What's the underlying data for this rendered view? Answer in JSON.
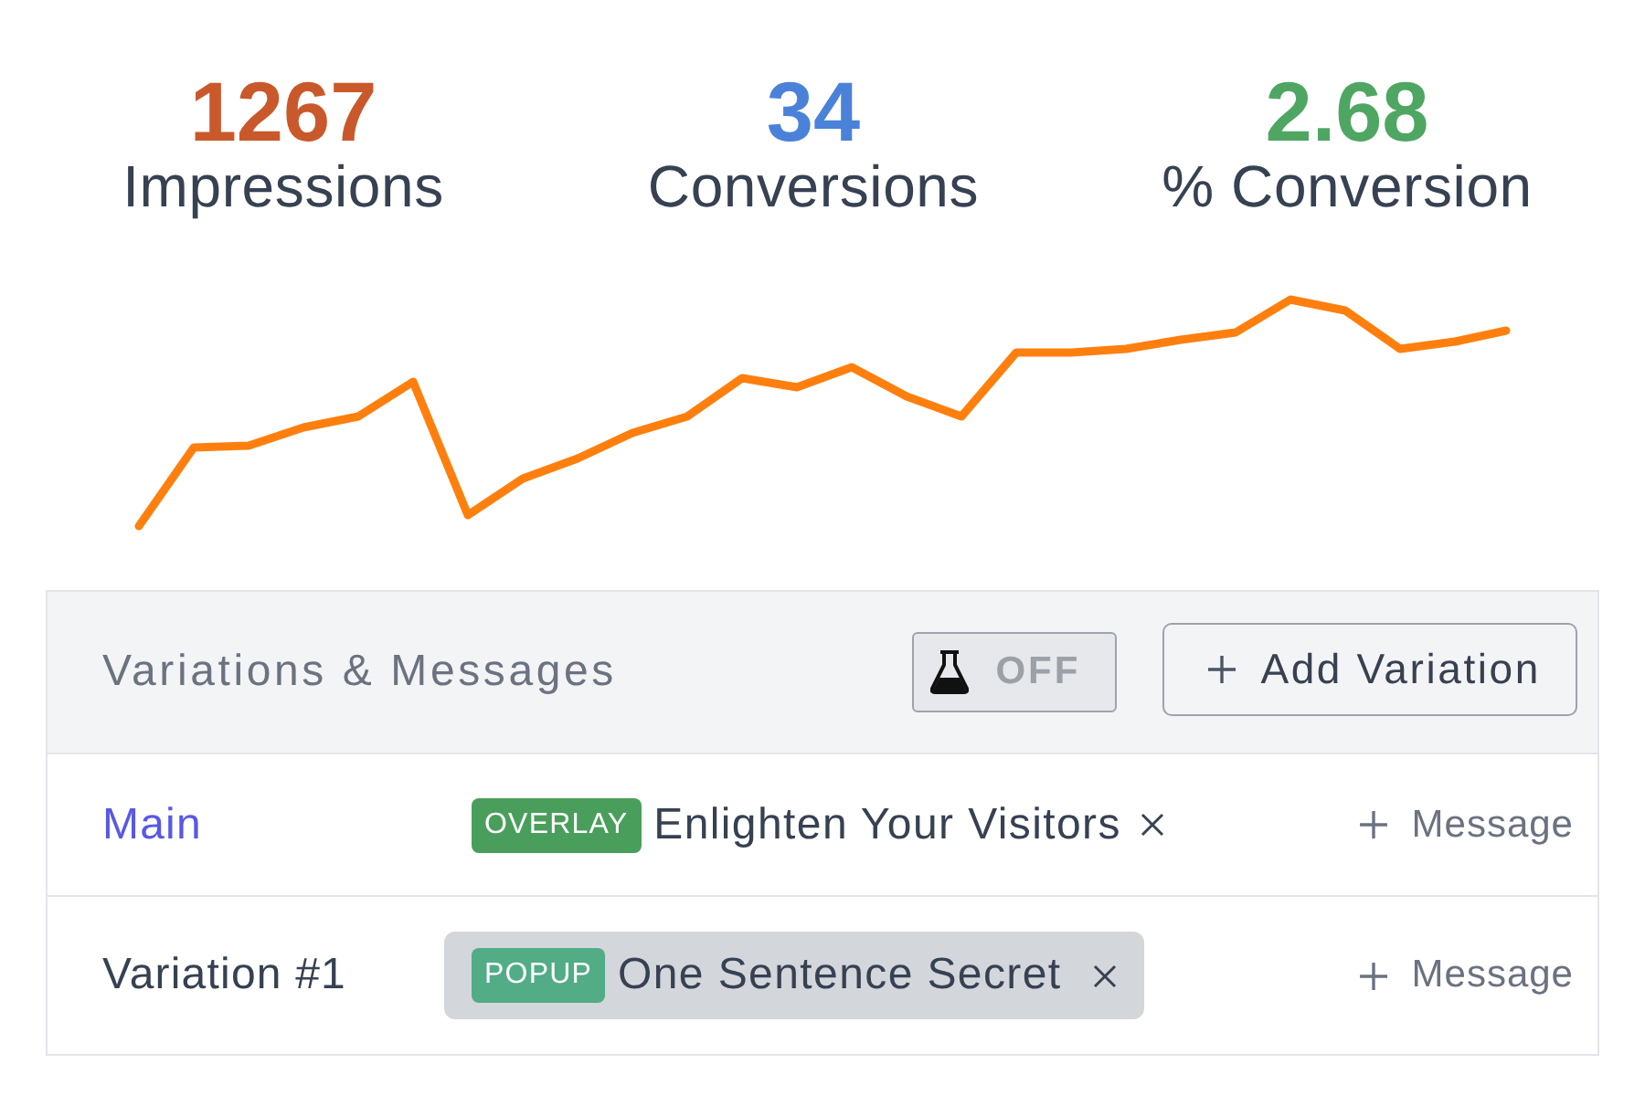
{
  "stats": [
    {
      "value": "1267",
      "label": "Impressions",
      "color": "#c9592b"
    },
    {
      "value": "34",
      "label": "Conversions",
      "color": "#4b82d9"
    },
    {
      "value": "2.68",
      "label": "% Conversion",
      "color": "#4fa663"
    }
  ],
  "variations": {
    "title": "Variations & Messages",
    "test_toggle": {
      "label": "OFF",
      "on": false
    },
    "add_button": "Add Variation",
    "rows": [
      {
        "name": "Main",
        "selected": true,
        "messages": [
          {
            "type": "OVERLAY",
            "color": "#4a9e5c",
            "title": "Enlighten Your Visitors",
            "selected": false
          }
        ],
        "add_message": "Message"
      },
      {
        "name": "Variation #1",
        "selected": false,
        "messages": [
          {
            "type": "POPUP",
            "color": "#52ac86",
            "title": "One Sentence Secret",
            "selected": true
          }
        ],
        "add_message": "Message"
      }
    ]
  }
}
